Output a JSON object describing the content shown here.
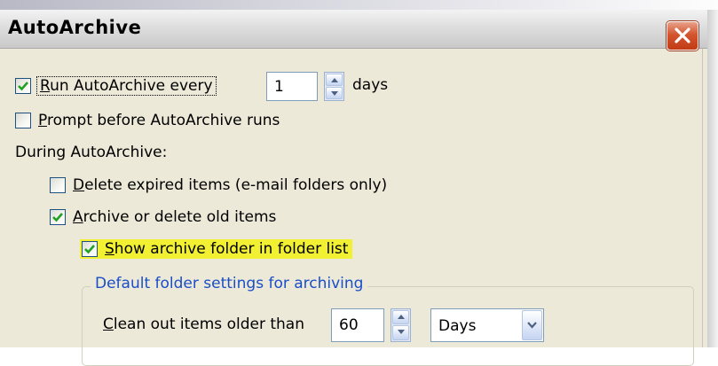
{
  "window": {
    "title": "AutoArchive",
    "close_label": "close"
  },
  "options": {
    "run_every": {
      "label": "Run AutoArchive every",
      "checked": true,
      "value": "1",
      "unit": "days"
    },
    "prompt_before": {
      "label": "Prompt before AutoArchive runs",
      "checked": false
    },
    "during_label": "During AutoArchive:",
    "delete_expired": {
      "label": "Delete expired items (e-mail folders only)",
      "checked": false
    },
    "archive_old": {
      "label": "Archive or delete old items",
      "checked": true
    },
    "show_folder": {
      "label": "Show archive folder in folder list",
      "checked": true
    }
  },
  "defaults_group": {
    "legend": "Default folder settings for archiving",
    "clean_label": "Clean out items older than",
    "clean_value": "60",
    "clean_unit_selected": "Days"
  },
  "colors": {
    "dialog_bg": "#ece9d8",
    "highlight": "#f2f032",
    "group_legend": "#1a4ec7",
    "check": "#21a121",
    "close_red": "#c23b14"
  }
}
